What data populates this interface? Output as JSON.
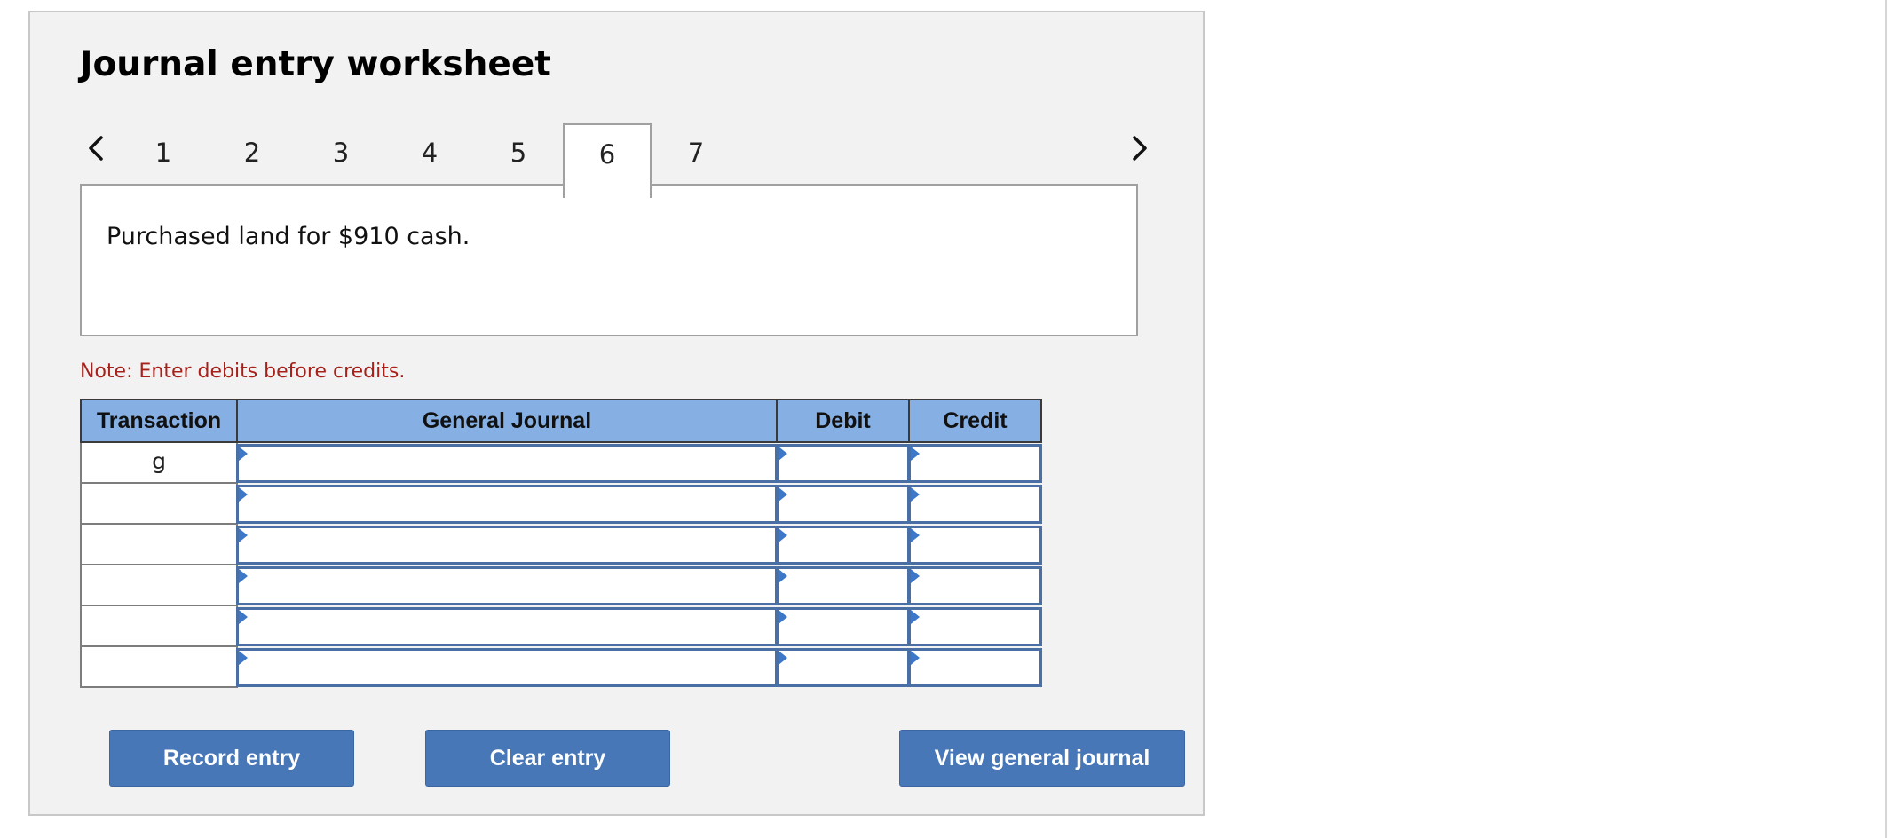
{
  "worksheet": {
    "title": "Journal entry worksheet",
    "nav": {
      "prev_icon": "chevron-left-icon",
      "next_icon": "chevron-right-icon"
    },
    "tabs": [
      {
        "label": "1",
        "active": false
      },
      {
        "label": "2",
        "active": false
      },
      {
        "label": "3",
        "active": false
      },
      {
        "label": "4",
        "active": false
      },
      {
        "label": "5",
        "active": false
      },
      {
        "label": "6",
        "active": true
      },
      {
        "label": "7",
        "active": false
      }
    ],
    "description": "Purchased land for $910 cash.",
    "note": "Note: Enter debits before credits."
  },
  "journal": {
    "headers": {
      "transaction": "Transaction",
      "general_journal": "General Journal",
      "debit": "Debit",
      "credit": "Credit"
    },
    "rows": [
      {
        "transaction": "g",
        "general_journal": "",
        "debit": "",
        "credit": ""
      },
      {
        "transaction": "",
        "general_journal": "",
        "debit": "",
        "credit": ""
      },
      {
        "transaction": "",
        "general_journal": "",
        "debit": "",
        "credit": ""
      },
      {
        "transaction": "",
        "general_journal": "",
        "debit": "",
        "credit": ""
      },
      {
        "transaction": "",
        "general_journal": "",
        "debit": "",
        "credit": ""
      },
      {
        "transaction": "",
        "general_journal": "",
        "debit": "",
        "credit": ""
      }
    ]
  },
  "buttons": {
    "record": "Record entry",
    "clear": "Clear entry",
    "view": "View general journal"
  },
  "colors": {
    "header_fill": "#86b0e4",
    "button_fill": "#4877b8",
    "note_text": "#a8201a",
    "input_border": "#4a6fa5"
  }
}
